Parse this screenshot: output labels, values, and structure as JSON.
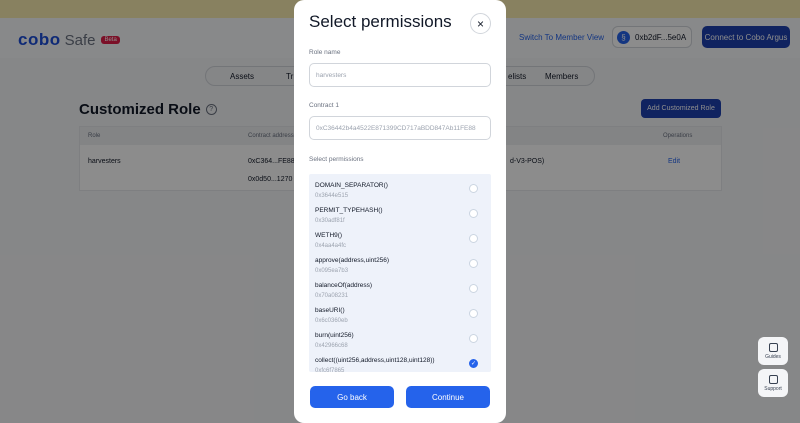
{
  "header": {
    "logo_text": "cobo",
    "logo_safe": "Safe",
    "beta": "Beta",
    "switch_member": "Switch To Member View",
    "wallet_initial": "§",
    "wallet_address": "0xb2dF...5e0A",
    "connect_argus": "Connect to Cobo Argus"
  },
  "tabs": [
    {
      "label": "Assets"
    },
    {
      "label": "Tr"
    },
    {
      "label": "elists"
    },
    {
      "label": "Members"
    }
  ],
  "page": {
    "title": "Customized Role",
    "help": "?",
    "add_button": "Add Customized Role"
  },
  "table": {
    "headers": {
      "role": "Role",
      "contract": "Contract address",
      "operations": "Operations"
    },
    "row": {
      "role": "harvesters",
      "contract1": "0xC364...FE88",
      "contract2": "0x0d50...1270",
      "extra": "d-V3-POS)",
      "edit": "Edit"
    }
  },
  "side_widgets": {
    "guides": "Guides",
    "support": "Support"
  },
  "modal": {
    "title": "Select permissions",
    "close": "×",
    "role_name_label": "Role name",
    "role_name_value": "harvesters",
    "contract_label": "Contract 1",
    "contract_value": "0xC36442b4a4522E871399CD717aBDD847Ab11FE88",
    "permissions_label": "Select permissions",
    "permissions": [
      {
        "name": "DOMAIN_SEPARATOR()",
        "sig": "0x3644e515",
        "checked": false
      },
      {
        "name": "PERMIT_TYPEHASH()",
        "sig": "0x30adf81f",
        "checked": false
      },
      {
        "name": "WETH9()",
        "sig": "0x4aa4a4fc",
        "checked": false
      },
      {
        "name": "approve(address,uint256)",
        "sig": "0x095ea7b3",
        "checked": false
      },
      {
        "name": "balanceOf(address)",
        "sig": "0x70a08231",
        "checked": false
      },
      {
        "name": "baseURI()",
        "sig": "0x6c0360eb",
        "checked": false
      },
      {
        "name": "burn(uint256)",
        "sig": "0x42966c68",
        "checked": false
      },
      {
        "name": "collect((uint256,address,uint128,uint128))",
        "sig": "0xfc6f7865",
        "checked": true
      }
    ],
    "back_button": "Go back",
    "continue_button": "Continue"
  }
}
